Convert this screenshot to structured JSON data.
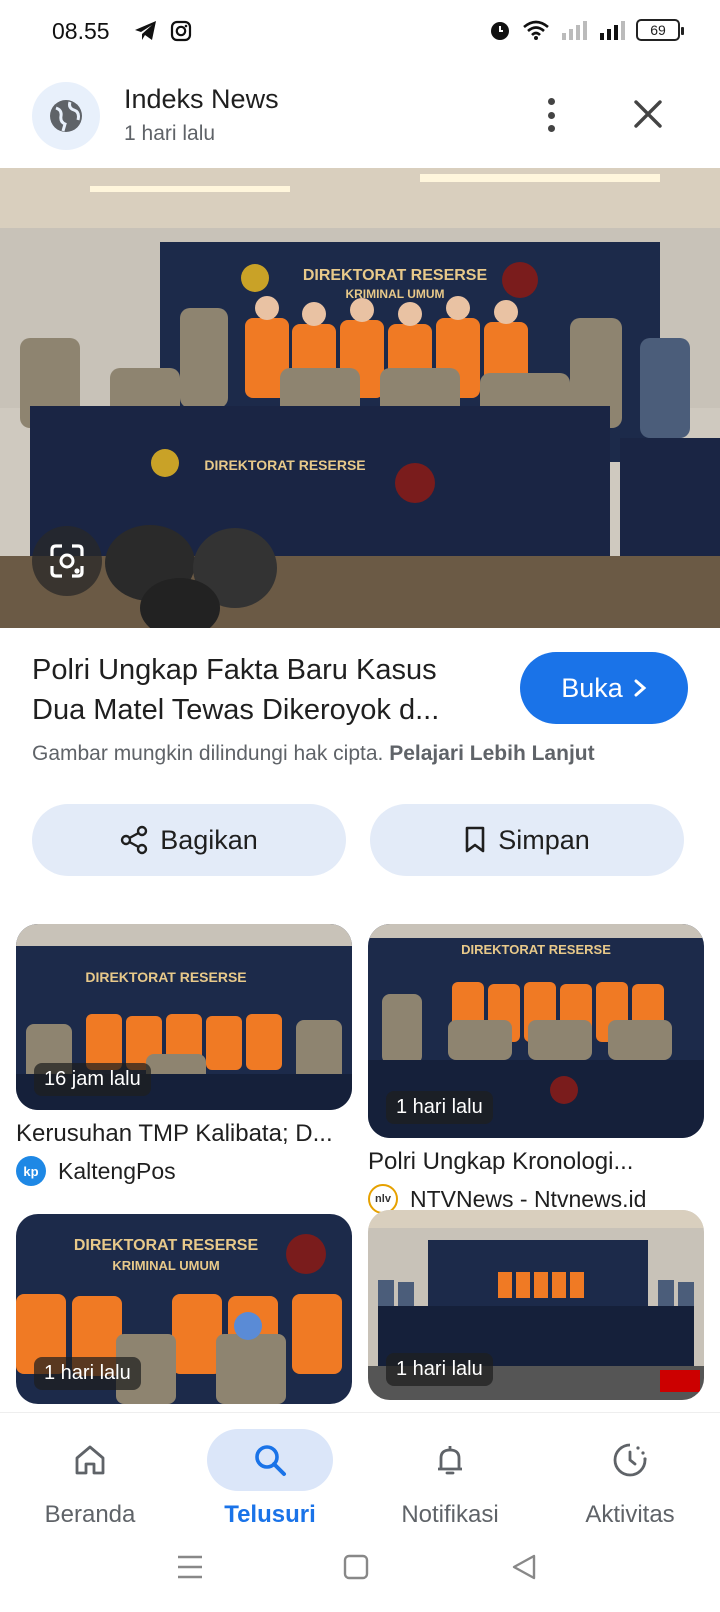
{
  "status_bar": {
    "time": "08.55",
    "battery": "69"
  },
  "header": {
    "title": "Indeks News",
    "subtitle": "1 hari lalu"
  },
  "result": {
    "title_line1": "Polri Ungkap Fakta Baru Kasus",
    "title_line2": "Dua Matel Tewas Dikeroyok d...",
    "open_label": "Buka",
    "copyright_text": "Gambar mungkin dilindungi hak cipta.",
    "learn_more": "Pelajari Lebih Lanjut",
    "hero_banner_top": "DIREKTORAT RESERSE",
    "hero_banner_sub": "KRIMINAL UMUM"
  },
  "actions": {
    "share_label": "Bagikan",
    "save_label": "Simpan"
  },
  "related": [
    {
      "time": "16 jam lalu",
      "title": "Kerusuhan TMP Kalibata; D...",
      "source": "KaltengPos",
      "logo": "kp",
      "logo_color": "#1e88e5"
    },
    {
      "time": "1 hari lalu",
      "title": "Polri Ungkap Kronologi...",
      "source": "NTVNews - Ntvnews.id",
      "logo": "nlv",
      "logo_color": "#e6a100"
    },
    {
      "time": "1 hari lalu",
      "title": "",
      "source": "",
      "logo": "",
      "logo_color": "#000000"
    },
    {
      "time": "1 hari lalu",
      "title": "",
      "source": "",
      "logo": "",
      "logo_color": "#000000"
    }
  ],
  "bottom_nav": {
    "home": "Beranda",
    "search": "Telusuri",
    "notifications": "Notifikasi",
    "activity": "Aktivitas"
  },
  "colors": {
    "accent": "#1a73e8",
    "pill_bg": "#e3ebf8",
    "orange_uniform": "#f07a24",
    "navy_backdrop": "#1c2a4a"
  }
}
